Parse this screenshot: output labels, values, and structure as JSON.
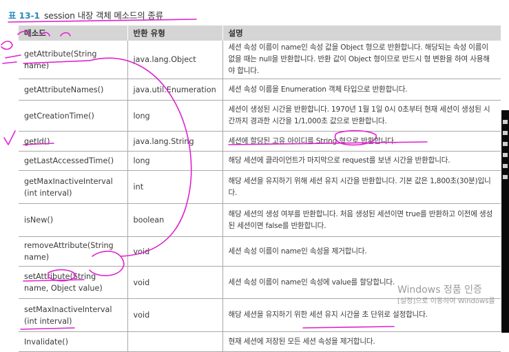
{
  "caption": {
    "number": "표 13-1",
    "title": "session 내장 객체 메소드의 종류"
  },
  "table": {
    "headers": [
      "메소드",
      "반환 유형",
      "설명"
    ],
    "rows": [
      {
        "method": "getAttribute(String name)",
        "type": "java.lang.Object",
        "desc": "세션 속성 이름이 name인 속성 값을 Object 형으로 반환합니다. 해당되는 속성 이름이 없을 때는 null을 반환합니다. 반환 값이 Object 형이므로 반드시 형 변환을 하여 사용해야 합니다."
      },
      {
        "method": "getAttributeNames()",
        "type": "java.util.Enumeration",
        "desc": "세션 속성 이름을 Enumeration 객체 타입으로 반환합니다."
      },
      {
        "method": "getCreationTime()",
        "type": "long",
        "desc": "세션이 생성된 시간을 반환합니다. 1970년 1월 1일 0시 0초부터 현재 세션이 생성된 시간까지 경과한 시간을 1/1,000초 값으로 반환합니다."
      },
      {
        "method": "getId()",
        "type": "java.lang.String",
        "desc": "세션에 할당된 고유 아이디를 String 형으로 반환합니다."
      },
      {
        "method": "getLastAccessedTime()",
        "type": "long",
        "desc": "해당 세션에 클라이언트가 마지막으로 request를 보낸 시간을 반환합니다."
      },
      {
        "method": "getMaxInactiveInterval (int interval)",
        "type": "int",
        "desc": "해당 세션을 유지하기 위해 세션 유지 시간을 반환합니다. 기본 값은 1,800초(30분)입니다."
      },
      {
        "method": "isNew()",
        "type": "boolean",
        "desc": "해당 세션의 생성 여부를 반환합니다. 처음 생성된 세션이면 true를 반환하고 이전에 생성된 세션이면 false를 반환합니다."
      },
      {
        "method": "removeAttribute(String name)",
        "type": "void",
        "desc": "세션 속성 이름이 name인 속성을 제거합니다."
      },
      {
        "method": "setAttribute(String name, Object value)",
        "type": "void",
        "desc": "세션 속성 이름이 name인 속성에 value를 할당합니다."
      },
      {
        "method": "setMaxInactiveInterval (int interval)",
        "type": "void",
        "desc": "해당 세션을 유지하기 위한 세션 유지 시간을 초 단위로 설정합니다."
      },
      {
        "method": "Invalidate()",
        "type": "",
        "desc": "현재 세션에 저장된 모든 세션 속성을 제거합니다."
      }
    ]
  },
  "watermark": {
    "line1": "Windows 정품 인증",
    "line2": "[설정]으로 이동하여 Windows를"
  },
  "colors": {
    "caption": "#2a8cc0",
    "header_bg": "#d5d5d5",
    "ink": "#e020d0",
    "rule": "#a8a8a8"
  }
}
